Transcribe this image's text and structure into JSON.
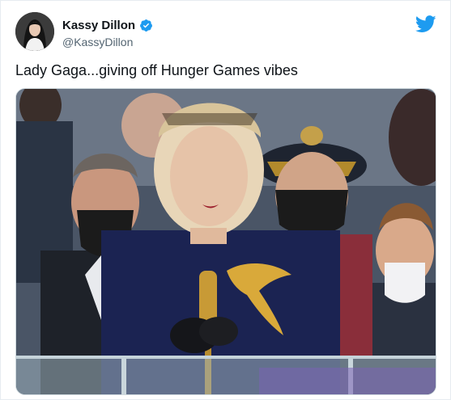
{
  "tweet": {
    "user": {
      "name": "Kassy Dillon",
      "handle": "@KassyDillon",
      "verified": true,
      "avatar_icon": "profile-photo"
    },
    "text": "Lady Gaga...giving off Hunger Games vibes",
    "brand_icon": "twitter-bird-icon",
    "media": {
      "type": "photo",
      "icon": "photo-placeholder"
    }
  },
  "colors": {
    "twitter_blue": "#1d9bf0",
    "verified_blue": "#1d9bf0",
    "handle_gray": "#536471",
    "text_dark": "#0f1419",
    "border": "#cfd9de"
  }
}
